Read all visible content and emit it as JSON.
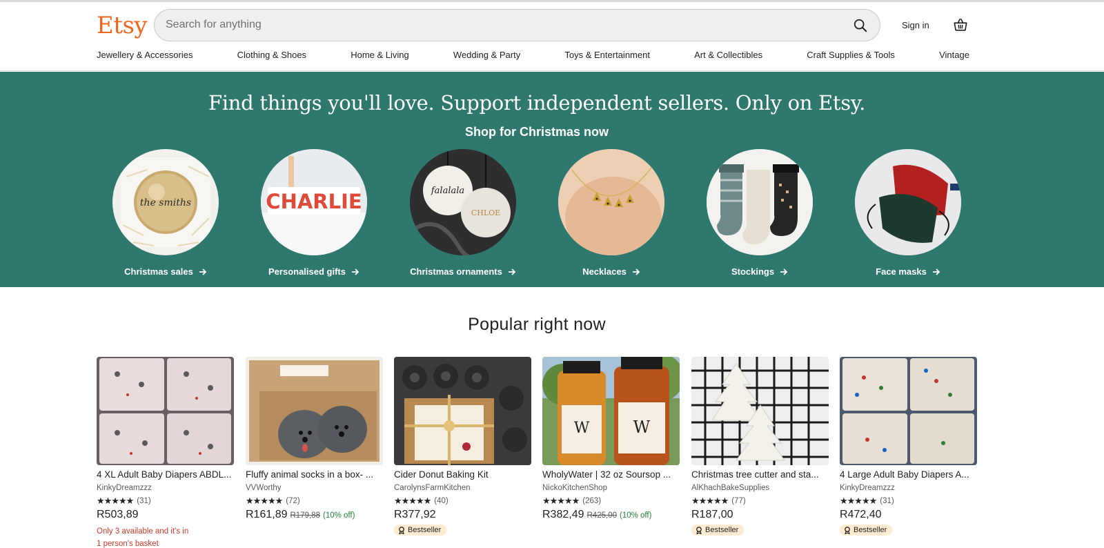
{
  "header": {
    "logo": "Etsy",
    "search_placeholder": "Search for anything",
    "signin": "Sign in",
    "icons": {
      "search": "search-icon",
      "basket": "basket-icon"
    }
  },
  "categories": [
    "Jewellery & Accessories",
    "Clothing & Shoes",
    "Home & Living",
    "Wedding & Party",
    "Toys & Entertainment",
    "Art & Collectibles",
    "Craft Supplies & Tools",
    "Vintage"
  ],
  "hero": {
    "title": "Find things you'll love. Support independent sellers. Only on Etsy.",
    "subtitle": "Shop for Christmas now",
    "items": [
      {
        "label": "Christmas sales"
      },
      {
        "label": "Personalised gifts",
        "text": "CHARLIE"
      },
      {
        "label": "Christmas ornaments",
        "text_a": "falalala",
        "text_b": "CHLOE"
      },
      {
        "label": "Necklaces"
      },
      {
        "label": "Stockings"
      },
      {
        "label": "Face masks"
      }
    ]
  },
  "popular": {
    "title": "Popular right now",
    "items": [
      {
        "title": "4 XL Adult Baby Diapers ABDL...",
        "shop": "KinkyDreamzzz",
        "stars": "★★★★★",
        "reviews": "(31)",
        "price": "R503,89",
        "orig": "",
        "discount": "",
        "stock_line1": "Only 3 available and it's in",
        "stock_line2": "1 person's basket",
        "badge": ""
      },
      {
        "title": "Fluffy animal socks in a box- ...",
        "shop": "VVWorthy",
        "stars": "★★★★★",
        "reviews": "(72)",
        "price": "R161,89",
        "orig": "R179,88",
        "discount": "(10% off)",
        "stock_line1": "",
        "stock_line2": "",
        "badge": ""
      },
      {
        "title": "Cider Donut Baking Kit",
        "shop": "CarolynsFarmKitchen",
        "stars": "★★★★★",
        "reviews": "(40)",
        "price": "R377,92",
        "orig": "",
        "discount": "",
        "stock_line1": "",
        "stock_line2": "",
        "badge": "Bestseller"
      },
      {
        "title": "WholyWater | 32 oz Soursop ...",
        "shop": "NickoKitchenShop",
        "stars": "★★★★★",
        "reviews": "(263)",
        "price": "R382,49",
        "orig": "R425,00",
        "discount": "(10% off)",
        "stock_line1": "",
        "stock_line2": "",
        "badge": ""
      },
      {
        "title": "Christmas tree cutter and sta...",
        "shop": "AlKhachBakeSupplies",
        "stars": "★★★★★",
        "reviews": "(77)",
        "price": "R187,00",
        "orig": "",
        "discount": "",
        "stock_line1": "",
        "stock_line2": "",
        "badge": "Bestseller"
      },
      {
        "title": "4 Large Adult Baby Diapers A...",
        "shop": "KinkyDreamzzz",
        "stars": "★★★★★",
        "reviews": "(31)",
        "price": "R472,40",
        "orig": "",
        "discount": "",
        "stock_line1": "",
        "stock_line2": "",
        "badge": "Bestseller"
      }
    ]
  },
  "colors": {
    "brand": "#F1641E",
    "hero_bg": "#2F786D",
    "badge_bg": "#FDEBD2",
    "stock_text": "#cc3a2a",
    "discount": "#258635"
  }
}
